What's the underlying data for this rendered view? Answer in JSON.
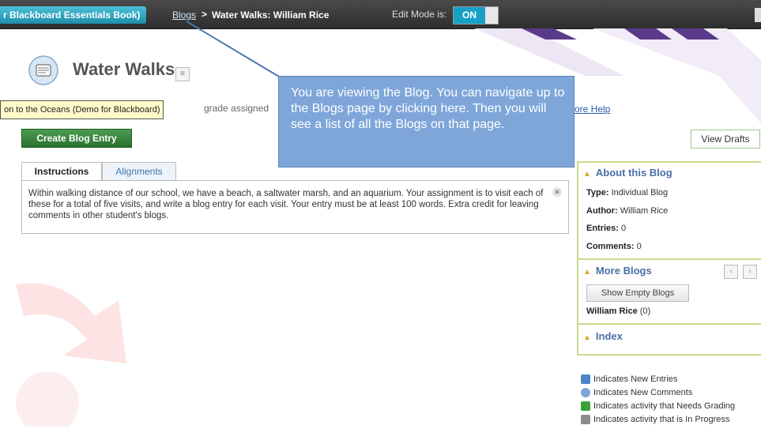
{
  "topbar": {
    "course_crumb": "r Blackboard Essentials Book)",
    "blogs_link": "Blogs",
    "separator": ">",
    "current": "Water Walks: William Rice",
    "edit_mode_label": "Edit Mode is:",
    "edit_mode_value": "ON"
  },
  "page": {
    "title": "Water Walks",
    "course_tooltip": "on to the Oceans (Demo for Blackboard)",
    "grade_text": "grade assigned",
    "more_help": "ore Help",
    "create_button": "Create Blog Entry",
    "view_drafts": "View Drafts"
  },
  "tabs": [
    "Instructions",
    "Alignments"
  ],
  "instructions": {
    "text": "Within walking distance of our school, we have a beach, a saltwater marsh, and an aquarium. Your assignment is to visit each of these for a total of five visits, and write a blog entry for each visit. Your entry must be at least 100 words. Extra credit for leaving comments in other student's blogs."
  },
  "callout": {
    "text": "You are viewing the Blog. You can navigate up to the Blogs page by clicking here. Then you will see a list of all the Blogs on that page."
  },
  "sidebar": {
    "about_title": "About this Blog",
    "type_label": "Type:",
    "type_value": "Individual Blog",
    "author_label": "Author:",
    "author_value": "William Rice",
    "entries_label": "Entries:",
    "entries_value": "0",
    "comments_label": "Comments:",
    "comments_value": "0",
    "more_title": "More Blogs",
    "show_empty": "Show Empty Blogs",
    "blog_name": "William Rice",
    "blog_count": "(0)",
    "index_title": "Index"
  },
  "legend": [
    {
      "icon": "new-entries-icon",
      "text": "Indicates New Entries",
      "color": "#4a86c8"
    },
    {
      "icon": "new-comments-icon",
      "text": "Indicates New Comments",
      "color": "#7aa7d8"
    },
    {
      "icon": "needs-grading-icon",
      "text": "Indicates activity that Needs Grading",
      "color": "#3aa13a"
    },
    {
      "icon": "in-progress-icon",
      "text": "Indicates activity that is In Progress",
      "color": "#8c8c8c"
    }
  ],
  "colors": {
    "accent": "#16a0c6",
    "create_button": "#2a722f",
    "callout": "#7ea6d9",
    "sidebar_border": "#c8dc8e"
  }
}
